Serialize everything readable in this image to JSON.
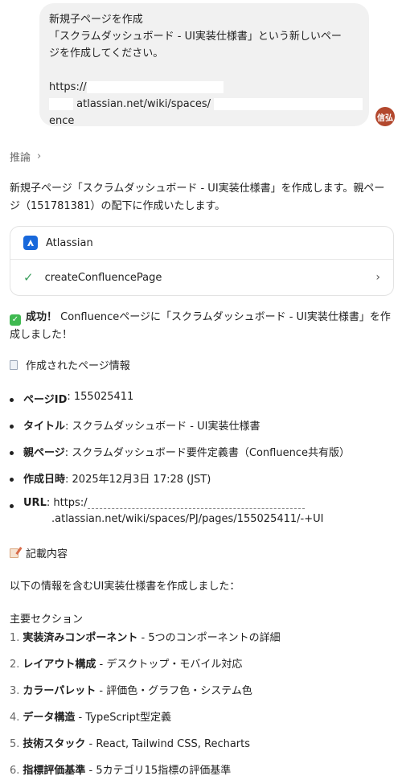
{
  "user_message": {
    "line1": "新規子ページを作成",
    "line2": "「スクラムダッシュボード - UI実装仕様書」という新しいペー",
    "line3": "ジを作成してください。",
    "url_part1": "https://",
    "url_part2": "atlassian.net/wiki/spaces/",
    "url_part3": "ence"
  },
  "avatar": {
    "label": "信弘",
    "color": "#b3482e"
  },
  "reasoning": {
    "label": "推論"
  },
  "intro_text": "新規子ページ「スクラムダッシュボード - UI実装仕様書」を作成します。親ページ（151781381）の配下に作成いたします。",
  "tool_card": {
    "provider": "Atlassian",
    "action": "createConfluencePage"
  },
  "result": {
    "success_label": "成功！",
    "success_text": "Confluenceページに「スクラムダッシュボード - UI実装仕様書」を作成しました！",
    "info_heading": "作成されたページ情報",
    "fields": [
      {
        "label": "ページID",
        "value": ": 155025411"
      },
      {
        "label": "タイトル",
        "value": ": スクラムダッシュボード - UI実装仕様書"
      },
      {
        "label": "親ページ",
        "value": ": スクラムダッシュボード要件定義書（Confluence共有版）"
      },
      {
        "label": "作成日時",
        "value": ": 2025年12月3日 17:28 (JST)"
      },
      {
        "label": "URL",
        "value": ": https:/"
      }
    ],
    "url_continuation": ".atlassian.net/wiki/spaces/PJ/pages/155025411/-+UI",
    "content_heading": "記載内容",
    "content_intro": "以下の情報を含むUI実装仕様書を作成しました：",
    "sections_heading": "主要セクション",
    "sections": [
      {
        "num": "1.",
        "title": "実装済みコンポーネント",
        "desc": " - 5つのコンポーネントの詳細"
      },
      {
        "num": "2.",
        "title": "レイアウト構成",
        "desc": " - デスクトップ・モバイル対応"
      },
      {
        "num": "3.",
        "title": "カラーパレット",
        "desc": " - 評価色・グラフ色・システム色"
      },
      {
        "num": "4.",
        "title": "データ構造",
        "desc": " - TypeScript型定義"
      },
      {
        "num": "5.",
        "title": "技術スタック",
        "desc": " - React, Tailwind CSS, Recharts"
      },
      {
        "num": "6.",
        "title": "指標評価基準",
        "desc": " - 5カテゴリ15指標の評価基準"
      }
    ]
  },
  "colors": {
    "accent_atlassian": "#1868db",
    "success": "#3a9e5c",
    "bubble_bg": "#f1f1f1"
  },
  "icons": [
    "chevron-right-icon",
    "atlassian-logo-icon",
    "check-icon",
    "success-check-icon",
    "document-icon",
    "memo-icon"
  ]
}
